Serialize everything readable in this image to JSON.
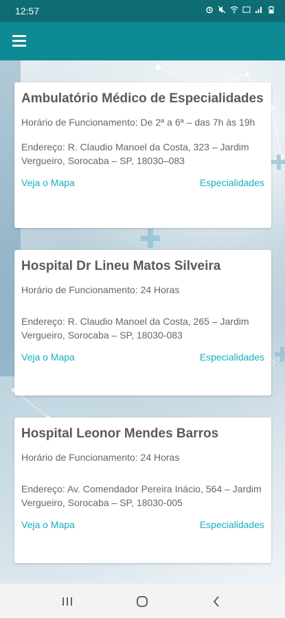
{
  "status_bar": {
    "time": "12:57"
  },
  "colors": {
    "app_bar": "#0e8a94",
    "status_bar": "#0d6c74",
    "link": "#16aebe"
  },
  "cards": [
    {
      "title": "Ambulatório Médico de Especialidades",
      "hours": "Horário de Funcionamento: De 2ª a 6ª – das 7h às 19h",
      "address": "Endereço: R. Claudio Manoel da Costa, 323 – Jardim Vergueiro, Sorocaba – SP, 18030–083",
      "map_link": "Veja o Mapa",
      "specialties_link": "Especialidades"
    },
    {
      "title": "Hospital Dr Lineu Matos Silveira",
      "hours": "Horário de Funcionamento: 24 Horas",
      "address": "Endereço: R. Claudio Manoel da Costa, 265 – Jardim Vergueiro, Sorocaba – SP, 18030-083",
      "map_link": "Veja o Mapa",
      "specialties_link": "Especialidades"
    },
    {
      "title": "Hospital Leonor Mendes Barros",
      "hours": "Horário de Funcionamento: 24 Horas",
      "address": "Endereço: Av. Comendador Pereira Inácio, 564 – Jardim Vergueiro, Sorocaba – SP, 18030-005",
      "map_link": "Veja o Mapa",
      "specialties_link": "Especialidades"
    }
  ]
}
